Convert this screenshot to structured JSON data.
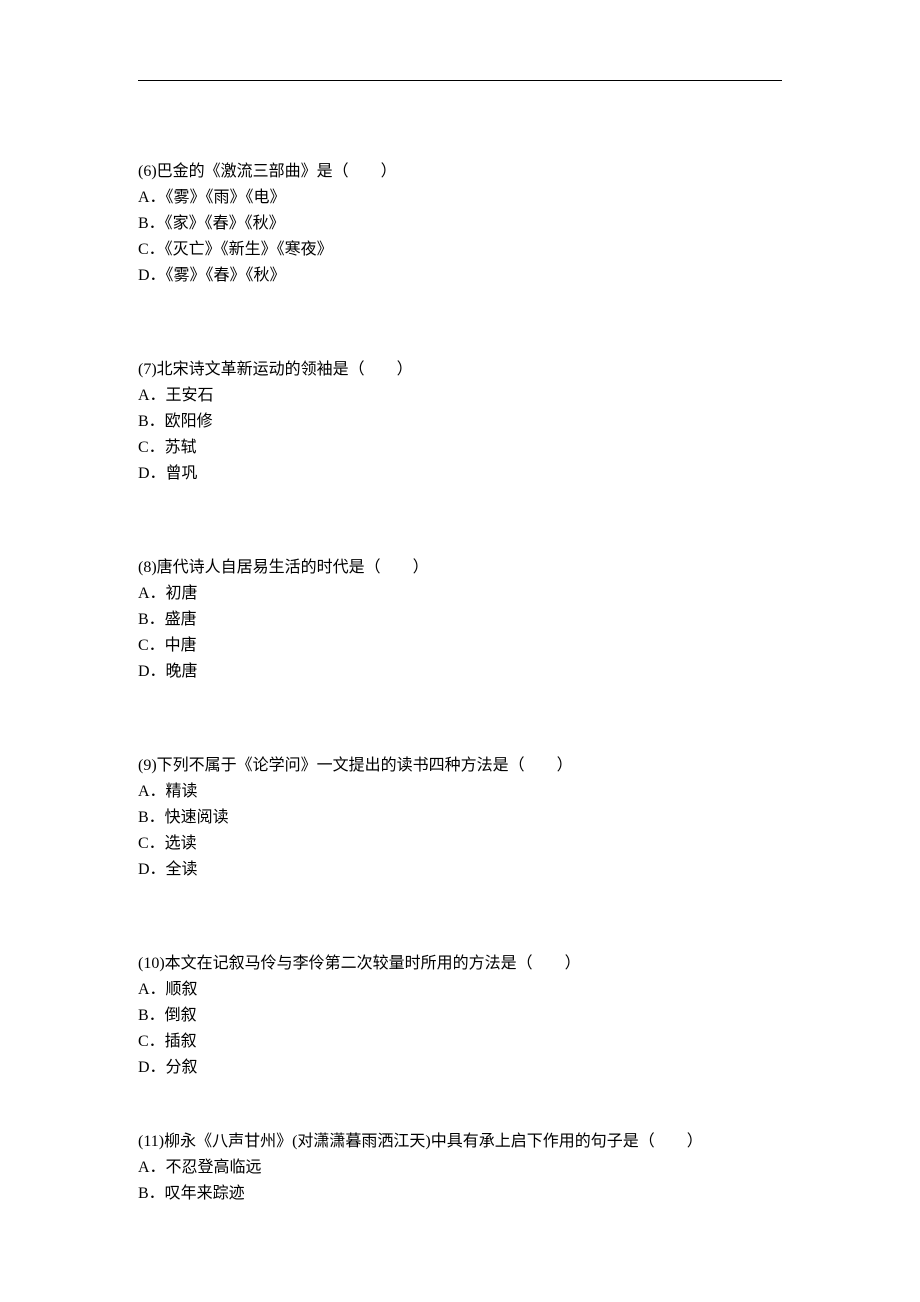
{
  "questions": [
    {
      "number": "(6)",
      "text": "巴金的《激流三部曲》是（　　）",
      "options": [
        "A．《雾》《雨》《电》",
        "B．《家》《春》《秋》",
        "C．《灭亡》《新生》《寒夜》",
        "D．《雾》《春》《秋》"
      ]
    },
    {
      "number": "(7)",
      "text": "北宋诗文革新运动的领袖是（　　）",
      "options": [
        "A．王安石",
        "B．欧阳修",
        "C．苏轼",
        "D．曾巩"
      ]
    },
    {
      "number": "(8)",
      "text": "唐代诗人自居易生活的时代是（　　）",
      "options": [
        "A．初唐",
        "B．盛唐",
        "C．中唐",
        "D．晚唐"
      ]
    },
    {
      "number": "(9)",
      "text": "下列不属于《论学问》一文提出的读书四种方法是（　　）",
      "options": [
        "A．精读",
        "B．快速阅读",
        "C．选读",
        "D．全读"
      ]
    },
    {
      "number": "(10)",
      "text": "本文在记叙马伶与李伶第二次较量时所用的方法是（　　）",
      "options": [
        "A．顺叙",
        "B．倒叙",
        "C．插叙",
        "D．分叙"
      ]
    },
    {
      "number": "(11)",
      "text": "柳永《八声甘州》(对潇潇暮雨洒江天)中具有承上启下作用的句子是（　　）",
      "options": [
        "A．不忍登高临远",
        "B．叹年来踪迹"
      ]
    }
  ]
}
